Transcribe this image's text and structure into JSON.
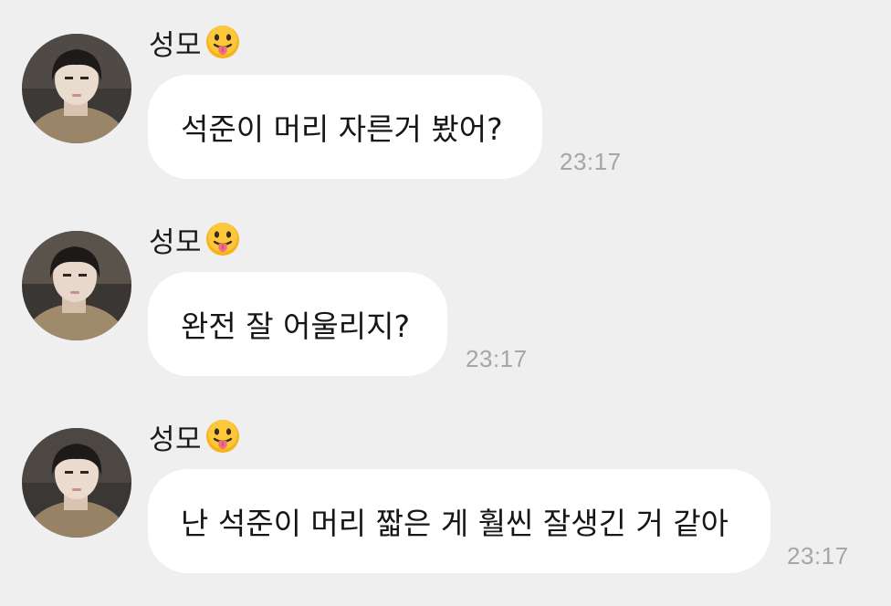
{
  "messages": [
    {
      "sender": "성모",
      "sender_emoji": "face-with-tongue-emoji",
      "text": "석준이 머리 자른거 봤어?",
      "time": "23:17"
    },
    {
      "sender": "성모",
      "sender_emoji": "face-with-tongue-emoji",
      "text": "완전 잘 어울리지?",
      "time": "23:17"
    },
    {
      "sender": "성모",
      "sender_emoji": "face-with-tongue-emoji",
      "text": "난 석준이 머리 짧은 게 훨씬 잘생긴 거 같아",
      "time": "23:17"
    }
  ],
  "colors": {
    "background": "#efefef",
    "bubble": "#ffffff",
    "text": "#161616",
    "time": "#a6a6a6",
    "emoji_face": "#f7b21c",
    "emoji_tongue": "#ef6d86"
  }
}
